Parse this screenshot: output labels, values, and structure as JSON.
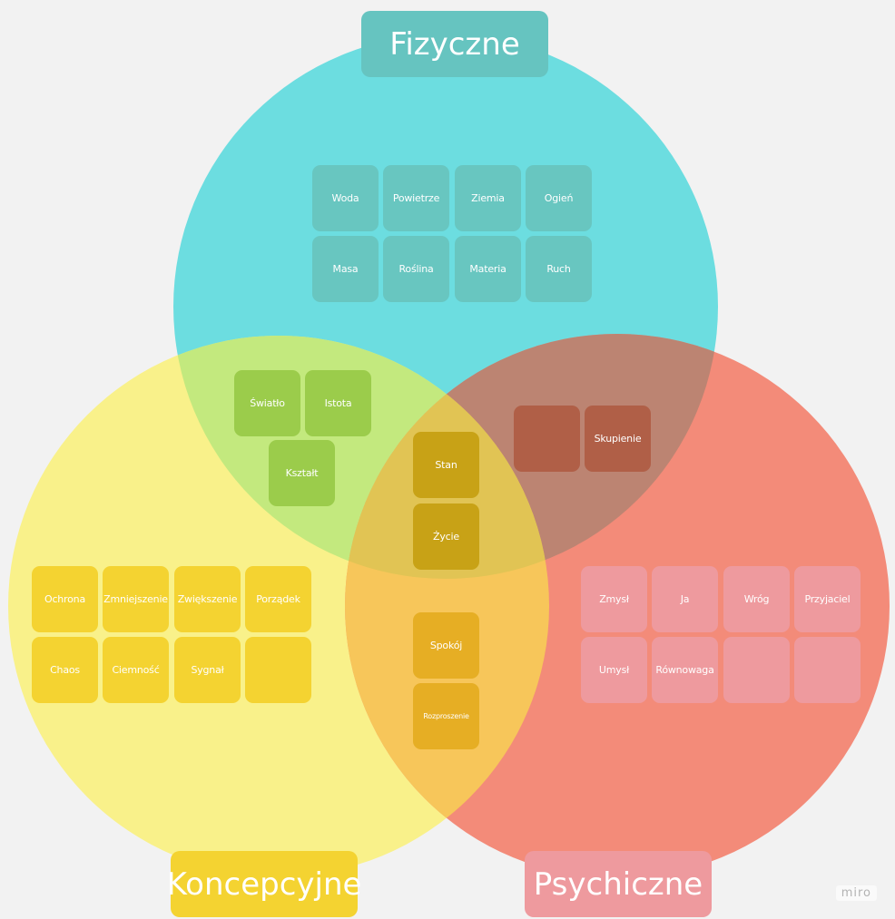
{
  "headers": {
    "physical": "Fizyczne",
    "conceptual": "Koncepcyjne",
    "psychic": "Psychiczne"
  },
  "colors": {
    "physical_circle": "#6cdde0",
    "conceptual_circle": "#f9f18a",
    "psychic_circle": "#f38b79",
    "physical_note": "#68c6c0",
    "conceptual_note": "#f4d331",
    "psychic_note": "#ee9a9e",
    "physical_conceptual_note": "#9bcc4b",
    "physical_psychic_note": "#b05f47",
    "conceptual_psychic_note": "#e6ae24",
    "center_note": "#c8a216",
    "physical_header": "#66c4c0",
    "conceptual_header": "#f4d331",
    "psychic_header": "#ee9a9e"
  },
  "notes": {
    "physical": [
      "Woda",
      "Powietrze",
      "Ziemia",
      "Ogień",
      "Masa",
      "Roślina",
      "Materia",
      "Ruch"
    ],
    "physical_conceptual": [
      "Światło",
      "Istota",
      "Kształt"
    ],
    "physical_psychic": [
      "",
      "Skupienie"
    ],
    "center": [
      "Stan",
      "Życie"
    ],
    "conceptual": [
      "Ochrona",
      "Zmniejszenie",
      "Zwiększenie",
      "Porządek",
      "Chaos",
      "Ciemność",
      "Sygnał",
      ""
    ],
    "conceptual_psychic": [
      "Spokój",
      "Rozproszenie"
    ],
    "psychic": [
      "Zmysł",
      "Ja",
      "Wróg",
      "Przyjaciel",
      "Umysł",
      "Równowaga",
      "",
      ""
    ]
  },
  "watermark": "miro"
}
